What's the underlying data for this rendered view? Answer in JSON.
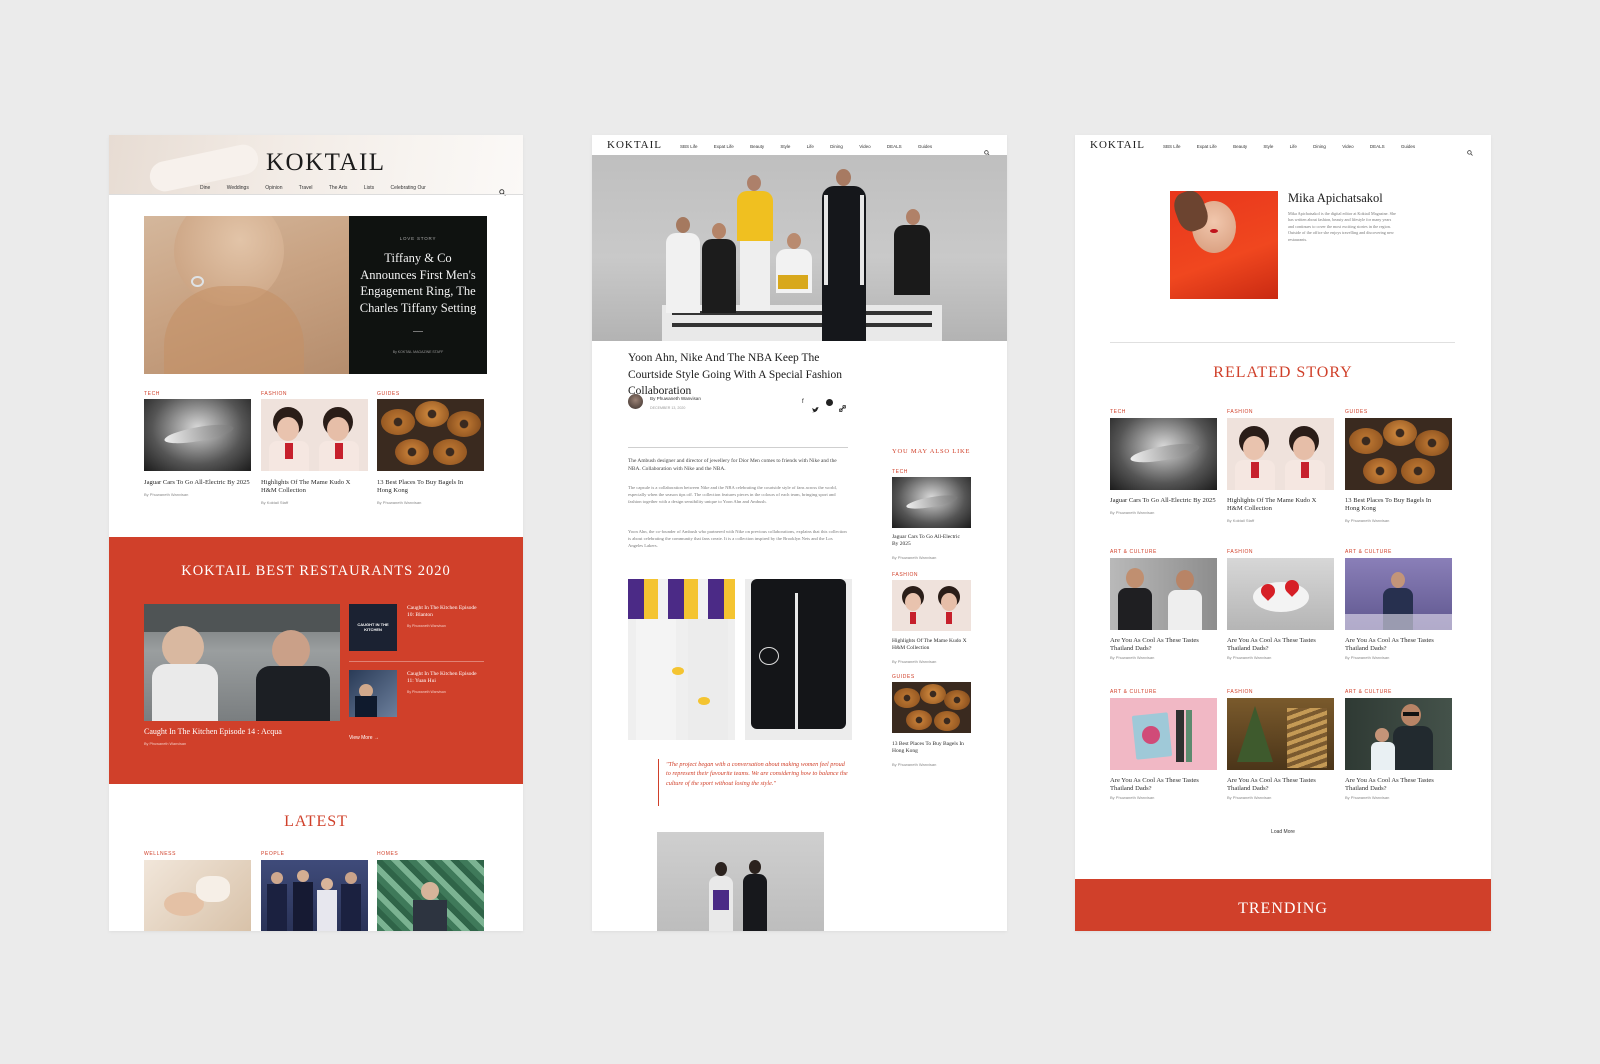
{
  "colors": {
    "accent": "#d0402a",
    "background": "#ebebeb",
    "panel": "#ffffff",
    "dark_card": "#0f1210"
  },
  "panel1": {
    "logo": "KOKTAIL",
    "nav": [
      "Dine",
      "Weddings",
      "Opinion",
      "Travel",
      "The Arts",
      "Lists",
      "Celebrating Our"
    ],
    "hero": {
      "kicker": "LOVE STORY",
      "title": "Tiffany & Co Announces First Men's Engagement Ring, The Charles Tiffany Setting",
      "byline": "By KOKTAIL MAGAZINE STAFF"
    },
    "cards": [
      {
        "cat": "TECH",
        "title": "Jaguar Cars To Go All-Electric By 2025",
        "by": "By Phuwaneth Wanvisan"
      },
      {
        "cat": "FASHION",
        "title": "Highlights Of The Mame Kudo X H&M Collection",
        "by": "By Koktail Staff"
      },
      {
        "cat": "GUIDES",
        "title": "13 Best Places To Buy Bagels In Hong Kong",
        "by": "By Phuwaneth Wanvisan"
      }
    ],
    "restaurants": {
      "heading": "KOKTAIL BEST RESTAURANTS 2020",
      "main_title": "Caught In The Kitchen Episode 14 : Acqua",
      "main_by": "By Phuwaneth Wanvisan",
      "side": [
        {
          "title": "Caught In The Kitchen Episode 10: Blanton",
          "by": "By Phuwaneth Wanvisan",
          "badge": "CAUGHT IN THE KITCHEN"
        },
        {
          "title": "Caught In The Kitchen Episode 11: Yuan Hui",
          "by": "By Phuwaneth Wanvisan"
        }
      ],
      "view_more": "View More →"
    },
    "latest": {
      "heading": "LATEST",
      "cats": [
        "WELLNESS",
        "PEOPLE",
        "HOMES"
      ]
    }
  },
  "panel2": {
    "logo": "KOKTAIL",
    "nav": [
      "SBS Life",
      "Expat Life",
      "Beauty",
      "Style",
      "Life",
      "Dining",
      "Video",
      "DEALS",
      "Guides"
    ],
    "article": {
      "title": "Yoon Ahn, Nike And The NBA Keep The Courtside Style Going With A Special Fashion Collaboration",
      "author": "By Phuwaneth Wanvisan",
      "date": "DECEMBER 13, 2020",
      "lead": "The Ambush designer and director of jewellery for Dior Men comes to friends with Nike and the NBA. Collaboration with Nike and the NBA.",
      "body1": "The capsule is a collaboration between Nike and the NBA celebrating the courtside style of fans across the world, especially when the season tips off. The collection features pieces in the colours of each team, bringing sport and fashion together with a design sensibility unique to Yoon Ahn and Ambush.",
      "body2": "Yoon Ahn, the co-founder of Ambush who partnered with Nike on previous collaborations, explains that this collection is about celebrating the community that fans create. It is a collection inspired by the Brooklyn Nets and the Los Angeles Lakers.",
      "quote": "\"The project began with a conversation about making women feel proud to represent their favourite teams. We are considering how to balance the culture of the sport without losing the style.\""
    },
    "sidebar": {
      "heading": "YOU MAY ALSO LIKE",
      "items": [
        {
          "cat": "TECH",
          "title": "Jaguar Cars To Go All-Electric By 2025",
          "by": "By Phuwaneth Wanvisan"
        },
        {
          "cat": "FASHION",
          "title": "Highlights Of The Mame Kudo X H&M Collection",
          "by": "By Phuwaneth Wanvisan"
        },
        {
          "cat": "GUIDES",
          "title": "13 Best Places To Buy Bagels In Hong Kong",
          "by": "By Phuwaneth Wanvisan"
        }
      ]
    }
  },
  "panel3": {
    "logo": "KOKTAIL",
    "nav": [
      "SBS Life",
      "Expat Life",
      "Beauty",
      "Style",
      "Life",
      "Dining",
      "Video",
      "DEALS",
      "Guides"
    ],
    "author": {
      "name": "Mika Apichatsakol",
      "bio": "Mika Apichatsakol is the digital editor at Koktail Magazine. She has written about fashion, beauty and lifestyle for many years and continues to cover the most exciting stories in the region. Outside of the office she enjoys travelling and discovering new restaurants."
    },
    "related": {
      "heading": "RELATED STORY",
      "rows": [
        [
          {
            "cat": "TECH",
            "title": "Jaguar Cars To Go All-Electric By 2025",
            "by": "By Phuwaneth Wanvisan"
          },
          {
            "cat": "FASHION",
            "title": "Highlights Of The Mame Kudo X H&M Collection",
            "by": "By Koktail Staff"
          },
          {
            "cat": "GUIDES",
            "title": "13 Best Places To Buy Bagels In Hong Kong",
            "by": "By Phuwaneth Wanvisan"
          }
        ],
        [
          {
            "cat": "ART & CULTURE",
            "title": "Are You As Cool As These Tastes Thailand Dads?",
            "by": "By Phuwaneth Wanvisan"
          },
          {
            "cat": "FASHION",
            "title": "Are You As Cool As These Tastes Thailand Dads?",
            "by": "By Phuwaneth Wanvisan"
          },
          {
            "cat": "ART & CULTURE",
            "title": "Are You As Cool As These Tastes Thailand Dads?",
            "by": "By Phuwaneth Wanvisan"
          }
        ],
        [
          {
            "cat": "ART & CULTURE",
            "title": "Are You As Cool As These Tastes Thailand Dads?",
            "by": "By Phuwaneth Wanvisan"
          },
          {
            "cat": "FASHION",
            "title": "Are You As Cool As These Tastes Thailand Dads?",
            "by": "By Phuwaneth Wanvisan"
          },
          {
            "cat": "ART & CULTURE",
            "title": "Are You As Cool As These Tastes Thailand Dads?",
            "by": "By Phuwaneth Wanvisan"
          }
        ]
      ],
      "load_more": "Load More"
    },
    "trending": "TRENDING"
  }
}
